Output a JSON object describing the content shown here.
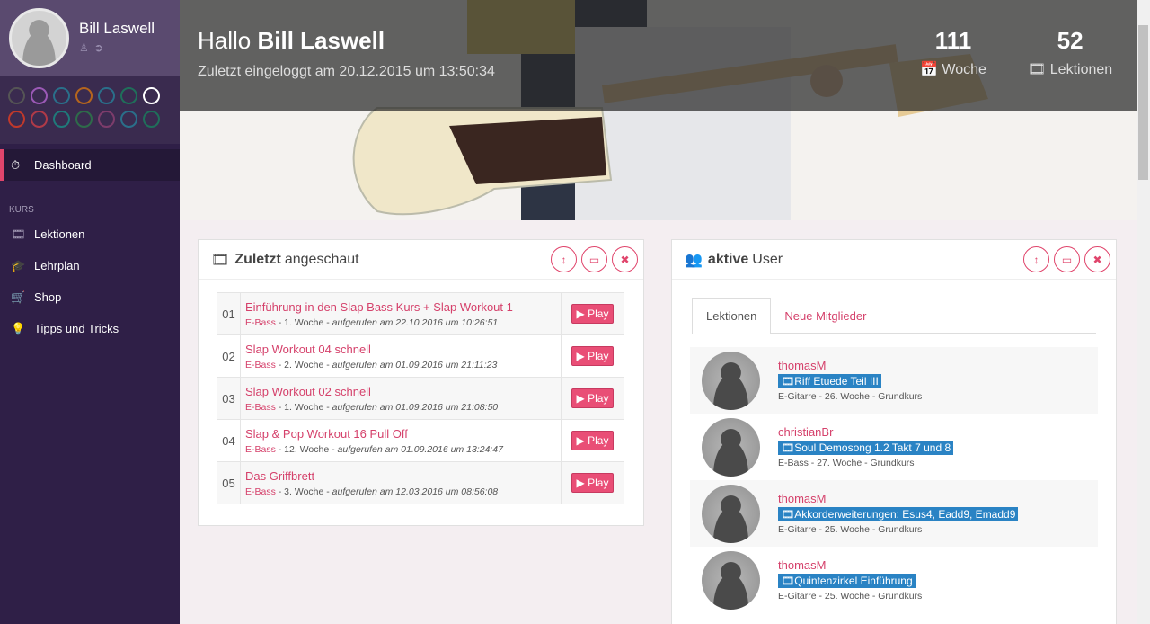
{
  "sidebar": {
    "username": "Bill Laswell",
    "nav": {
      "dashboard": "Dashboard",
      "section": "KURS",
      "items": [
        {
          "icon": "film-icon",
          "label": "Lektionen"
        },
        {
          "icon": "graduation-cap-icon",
          "label": "Lehrplan"
        },
        {
          "icon": "cart-icon",
          "label": "Shop"
        },
        {
          "icon": "lightbulb-icon",
          "label": "Tipps und Tricks"
        }
      ]
    },
    "swatch_colors": [
      [
        "#555",
        "#9b59b6",
        "#2a6f8a",
        "#b5651d",
        "#2a6f8a",
        "#1f6f5a",
        "#ffffff"
      ],
      [
        "#c0392b",
        "#b03a48",
        "#1f7a7a",
        "#2e6b4a",
        "#7d3c6b",
        "#2a6f8a",
        "#1f6f5a"
      ]
    ]
  },
  "header": {
    "greeting": "Hallo",
    "name": "Bill Laswell",
    "last_login": "Zuletzt eingeloggt am 20.12.2015 um 13:50:34",
    "stats": [
      {
        "value": "111",
        "label": "Woche",
        "icon": "calendar-icon"
      },
      {
        "value": "52",
        "label": "Lektionen",
        "icon": "film-icon"
      }
    ]
  },
  "recent": {
    "title_bold": "Zuletzt",
    "title_rest": "angeschaut",
    "play_label": "Play",
    "rows": [
      {
        "idx": "01",
        "title": "Einführung in den Slap Bass Kurs + Slap Workout 1",
        "inst": "E-Bass",
        "week": " - 1. Woche - ",
        "seen": "aufgerufen am 22.10.2016 um 10:26:51"
      },
      {
        "idx": "02",
        "title": "Slap Workout 04 schnell",
        "inst": "E-Bass",
        "week": " - 2. Woche - ",
        "seen": "aufgerufen am 01.09.2016 um 21:11:23"
      },
      {
        "idx": "03",
        "title": "Slap Workout 02 schnell",
        "inst": "E-Bass",
        "week": " - 1. Woche - ",
        "seen": "aufgerufen am 01.09.2016 um 21:08:50"
      },
      {
        "idx": "04",
        "title": "Slap & Pop Workout 16 Pull Off",
        "inst": "E-Bass",
        "week": " - 12. Woche - ",
        "seen": "aufgerufen am 01.09.2016 um 13:24:47"
      },
      {
        "idx": "05",
        "title": "Das Griffbrett",
        "inst": "E-Bass",
        "week": " - 3. Woche - ",
        "seen": "aufgerufen am 12.03.2016 um 08:56:08"
      }
    ]
  },
  "active_users": {
    "title_bold": "aktive",
    "title_rest": "User",
    "tabs": [
      "Lektionen",
      "Neue Mitglieder"
    ],
    "users": [
      {
        "name": "thomasM",
        "lesson": "Riff Etuede Teil III",
        "meta": "E-Gitarre - 26. Woche - Grundkurs"
      },
      {
        "name": "christianBr",
        "lesson": "Soul Demosong 1.2 Takt 7 und 8",
        "meta": "E-Bass - 27. Woche - Grundkurs"
      },
      {
        "name": "thomasM",
        "lesson": "Akkorderweiterungen: Esus4, Eadd9, Emadd9",
        "meta": "E-Gitarre - 25. Woche - Grundkurs"
      },
      {
        "name": "thomasM",
        "lesson": "Quintenzirkel Einführung",
        "meta": "E-Gitarre - 25. Woche - Grundkurs"
      }
    ]
  }
}
